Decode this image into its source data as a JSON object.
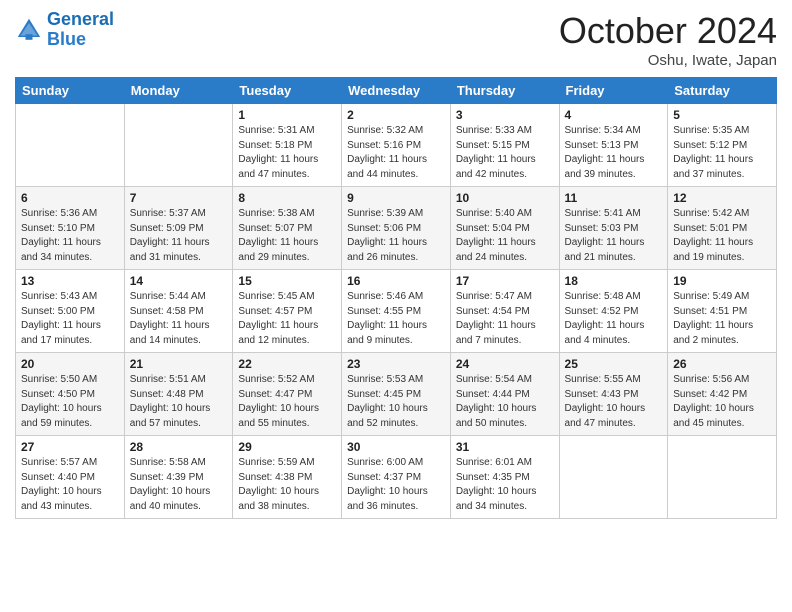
{
  "header": {
    "logo_general": "General",
    "logo_blue": "Blue",
    "month_title": "October 2024",
    "location": "Oshu, Iwate, Japan"
  },
  "days_of_week": [
    "Sunday",
    "Monday",
    "Tuesday",
    "Wednesday",
    "Thursday",
    "Friday",
    "Saturday"
  ],
  "weeks": [
    [
      {
        "day": "",
        "sunrise": "",
        "sunset": "",
        "daylight": ""
      },
      {
        "day": "",
        "sunrise": "",
        "sunset": "",
        "daylight": ""
      },
      {
        "day": "1",
        "sunrise": "Sunrise: 5:31 AM",
        "sunset": "Sunset: 5:18 PM",
        "daylight": "Daylight: 11 hours and 47 minutes."
      },
      {
        "day": "2",
        "sunrise": "Sunrise: 5:32 AM",
        "sunset": "Sunset: 5:16 PM",
        "daylight": "Daylight: 11 hours and 44 minutes."
      },
      {
        "day": "3",
        "sunrise": "Sunrise: 5:33 AM",
        "sunset": "Sunset: 5:15 PM",
        "daylight": "Daylight: 11 hours and 42 minutes."
      },
      {
        "day": "4",
        "sunrise": "Sunrise: 5:34 AM",
        "sunset": "Sunset: 5:13 PM",
        "daylight": "Daylight: 11 hours and 39 minutes."
      },
      {
        "day": "5",
        "sunrise": "Sunrise: 5:35 AM",
        "sunset": "Sunset: 5:12 PM",
        "daylight": "Daylight: 11 hours and 37 minutes."
      }
    ],
    [
      {
        "day": "6",
        "sunrise": "Sunrise: 5:36 AM",
        "sunset": "Sunset: 5:10 PM",
        "daylight": "Daylight: 11 hours and 34 minutes."
      },
      {
        "day": "7",
        "sunrise": "Sunrise: 5:37 AM",
        "sunset": "Sunset: 5:09 PM",
        "daylight": "Daylight: 11 hours and 31 minutes."
      },
      {
        "day": "8",
        "sunrise": "Sunrise: 5:38 AM",
        "sunset": "Sunset: 5:07 PM",
        "daylight": "Daylight: 11 hours and 29 minutes."
      },
      {
        "day": "9",
        "sunrise": "Sunrise: 5:39 AM",
        "sunset": "Sunset: 5:06 PM",
        "daylight": "Daylight: 11 hours and 26 minutes."
      },
      {
        "day": "10",
        "sunrise": "Sunrise: 5:40 AM",
        "sunset": "Sunset: 5:04 PM",
        "daylight": "Daylight: 11 hours and 24 minutes."
      },
      {
        "day": "11",
        "sunrise": "Sunrise: 5:41 AM",
        "sunset": "Sunset: 5:03 PM",
        "daylight": "Daylight: 11 hours and 21 minutes."
      },
      {
        "day": "12",
        "sunrise": "Sunrise: 5:42 AM",
        "sunset": "Sunset: 5:01 PM",
        "daylight": "Daylight: 11 hours and 19 minutes."
      }
    ],
    [
      {
        "day": "13",
        "sunrise": "Sunrise: 5:43 AM",
        "sunset": "Sunset: 5:00 PM",
        "daylight": "Daylight: 11 hours and 17 minutes."
      },
      {
        "day": "14",
        "sunrise": "Sunrise: 5:44 AM",
        "sunset": "Sunset: 4:58 PM",
        "daylight": "Daylight: 11 hours and 14 minutes."
      },
      {
        "day": "15",
        "sunrise": "Sunrise: 5:45 AM",
        "sunset": "Sunset: 4:57 PM",
        "daylight": "Daylight: 11 hours and 12 minutes."
      },
      {
        "day": "16",
        "sunrise": "Sunrise: 5:46 AM",
        "sunset": "Sunset: 4:55 PM",
        "daylight": "Daylight: 11 hours and 9 minutes."
      },
      {
        "day": "17",
        "sunrise": "Sunrise: 5:47 AM",
        "sunset": "Sunset: 4:54 PM",
        "daylight": "Daylight: 11 hours and 7 minutes."
      },
      {
        "day": "18",
        "sunrise": "Sunrise: 5:48 AM",
        "sunset": "Sunset: 4:52 PM",
        "daylight": "Daylight: 11 hours and 4 minutes."
      },
      {
        "day": "19",
        "sunrise": "Sunrise: 5:49 AM",
        "sunset": "Sunset: 4:51 PM",
        "daylight": "Daylight: 11 hours and 2 minutes."
      }
    ],
    [
      {
        "day": "20",
        "sunrise": "Sunrise: 5:50 AM",
        "sunset": "Sunset: 4:50 PM",
        "daylight": "Daylight: 10 hours and 59 minutes."
      },
      {
        "day": "21",
        "sunrise": "Sunrise: 5:51 AM",
        "sunset": "Sunset: 4:48 PM",
        "daylight": "Daylight: 10 hours and 57 minutes."
      },
      {
        "day": "22",
        "sunrise": "Sunrise: 5:52 AM",
        "sunset": "Sunset: 4:47 PM",
        "daylight": "Daylight: 10 hours and 55 minutes."
      },
      {
        "day": "23",
        "sunrise": "Sunrise: 5:53 AM",
        "sunset": "Sunset: 4:45 PM",
        "daylight": "Daylight: 10 hours and 52 minutes."
      },
      {
        "day": "24",
        "sunrise": "Sunrise: 5:54 AM",
        "sunset": "Sunset: 4:44 PM",
        "daylight": "Daylight: 10 hours and 50 minutes."
      },
      {
        "day": "25",
        "sunrise": "Sunrise: 5:55 AM",
        "sunset": "Sunset: 4:43 PM",
        "daylight": "Daylight: 10 hours and 47 minutes."
      },
      {
        "day": "26",
        "sunrise": "Sunrise: 5:56 AM",
        "sunset": "Sunset: 4:42 PM",
        "daylight": "Daylight: 10 hours and 45 minutes."
      }
    ],
    [
      {
        "day": "27",
        "sunrise": "Sunrise: 5:57 AM",
        "sunset": "Sunset: 4:40 PM",
        "daylight": "Daylight: 10 hours and 43 minutes."
      },
      {
        "day": "28",
        "sunrise": "Sunrise: 5:58 AM",
        "sunset": "Sunset: 4:39 PM",
        "daylight": "Daylight: 10 hours and 40 minutes."
      },
      {
        "day": "29",
        "sunrise": "Sunrise: 5:59 AM",
        "sunset": "Sunset: 4:38 PM",
        "daylight": "Daylight: 10 hours and 38 minutes."
      },
      {
        "day": "30",
        "sunrise": "Sunrise: 6:00 AM",
        "sunset": "Sunset: 4:37 PM",
        "daylight": "Daylight: 10 hours and 36 minutes."
      },
      {
        "day": "31",
        "sunrise": "Sunrise: 6:01 AM",
        "sunset": "Sunset: 4:35 PM",
        "daylight": "Daylight: 10 hours and 34 minutes."
      },
      {
        "day": "",
        "sunrise": "",
        "sunset": "",
        "daylight": ""
      },
      {
        "day": "",
        "sunrise": "",
        "sunset": "",
        "daylight": ""
      }
    ]
  ]
}
